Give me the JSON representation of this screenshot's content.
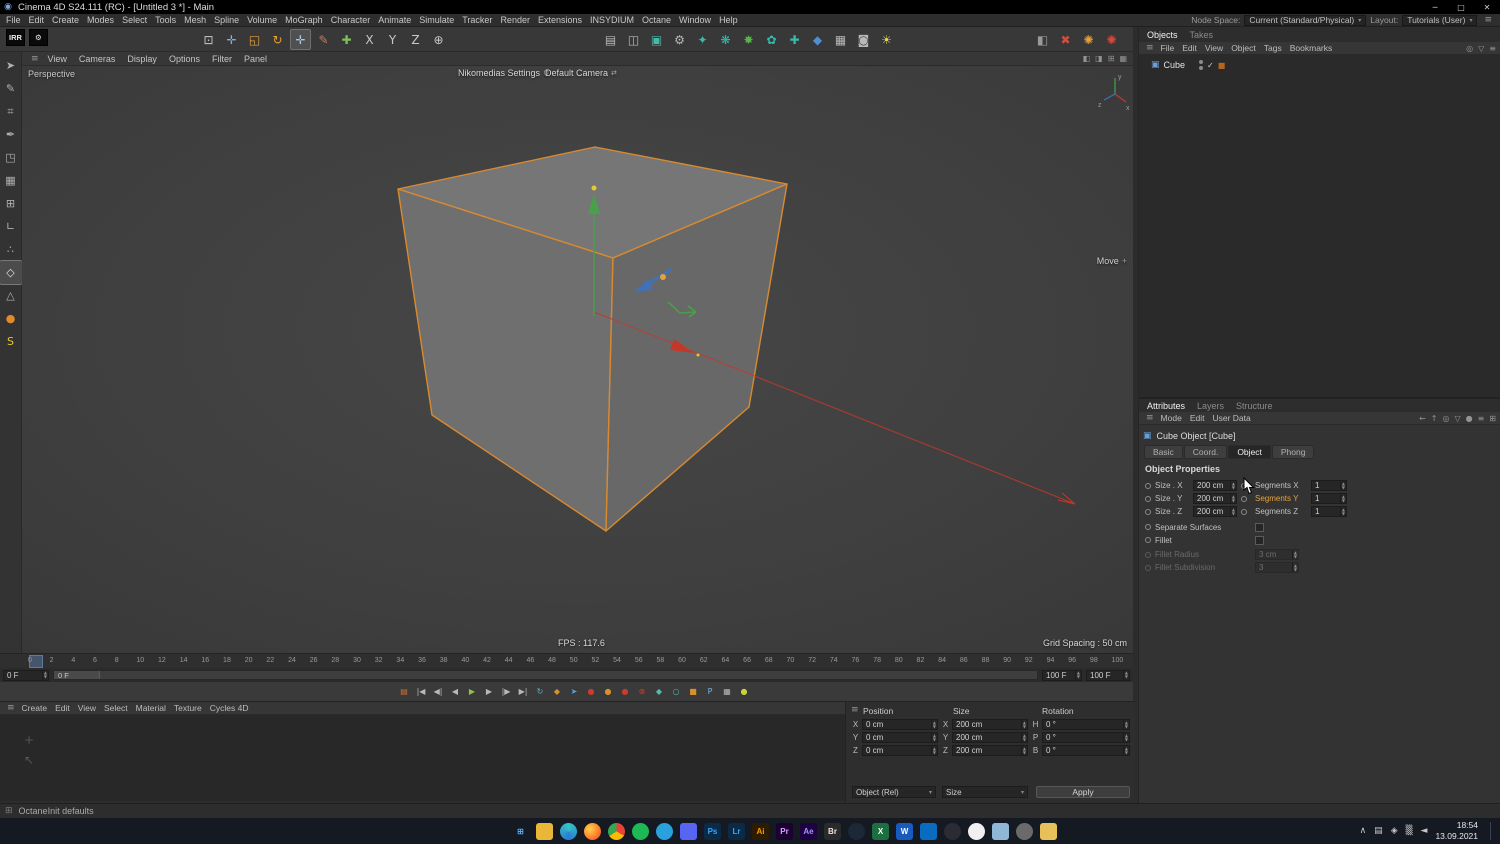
{
  "colors": {
    "accent_orange": "#e8932c",
    "cube_outline": "#d98a2f",
    "selection_blue": "#4a7fb5"
  },
  "icons": {
    "logo": "◉",
    "gear": "⚙",
    "hamburger": "≡",
    "caret_down": "▾",
    "cube": "▣",
    "check": "✓",
    "tag": "■",
    "grip": "≡",
    "move_plus": "+",
    "camera_switch": "⇄",
    "status_grid": "⊞",
    "ghost_plus": "+",
    "ghost_arrow": "↖"
  },
  "title_bar": {
    "title": "Cinema 4D S24.111 (RC) - [Untitled 3 *] - Main",
    "controls": [
      {
        "name": "minimize-button",
        "glyph": "─"
      },
      {
        "name": "maximize-button",
        "glyph": "□"
      },
      {
        "name": "close-button",
        "glyph": "✕"
      }
    ]
  },
  "menu_bar": {
    "items": [
      "File",
      "Edit",
      "Create",
      "Modes",
      "Select",
      "Tools",
      "Mesh",
      "Spline",
      "Volume",
      "MoGraph",
      "Character",
      "Animate",
      "Simulate",
      "Tracker",
      "Render",
      "Extensions",
      "INSYDIUM",
      "Octane",
      "Window",
      "Help"
    ],
    "node_space_label": "Node Space:",
    "node_space_value": "Current (Standard/Physical)",
    "layout_label": "Layout:",
    "layout_value": "Tutorials (User)"
  },
  "toolbar": {
    "left": [
      {
        "name": "irr-button",
        "label": "IRR"
      },
      {
        "name": "plugin-settings-button",
        "glyph": "⚙"
      }
    ],
    "tools": [
      {
        "name": "selection-tool-icon",
        "glyph": "⊡",
        "color": "#c8c8c8"
      },
      {
        "name": "move-tool-icon",
        "glyph": "✛",
        "color": "#7fb2e0"
      },
      {
        "name": "scale-tool-icon",
        "glyph": "◱",
        "color": "#e8a13a"
      },
      {
        "name": "rotate-tool-icon",
        "glyph": "↻",
        "color": "#e8a13a"
      },
      {
        "name": "active-tool-icon",
        "glyph": "✛",
        "color": "#a8c8e8",
        "cls": "pressed"
      },
      {
        "name": "sketch-tool-icon",
        "glyph": "✎",
        "color": "#c87a5a"
      },
      {
        "name": "add-primitive-icon",
        "glyph": "✚",
        "color": "#7fc05a"
      },
      {
        "name": "lock-x-button",
        "glyph": "X",
        "color": "#c8c8c8"
      },
      {
        "name": "lock-y-button",
        "glyph": "Y",
        "color": "#c8c8c8"
      },
      {
        "name": "lock-z-button",
        "glyph": "Z",
        "color": "#c8c8c8"
      },
      {
        "name": "coord-system-button",
        "glyph": "⊕",
        "color": "#c8c8c8"
      }
    ],
    "center": [
      {
        "name": "render-view-button",
        "glyph": "▤",
        "color": "#b8b8b8"
      },
      {
        "name": "render-region-button",
        "glyph": "◫",
        "color": "#b8b8b8"
      },
      {
        "name": "render-picture-viewer-button",
        "glyph": "▣",
        "color": "#4ab8a8"
      },
      {
        "name": "render-settings-button",
        "glyph": "⚙",
        "color": "#b8b8b8"
      },
      {
        "name": "insydium-fx-icon",
        "glyph": "✦",
        "color": "#3db8ac"
      },
      {
        "name": "insydium-particles-icon",
        "glyph": "❋",
        "color": "#3db8ac"
      },
      {
        "name": "insydium-explode-icon",
        "glyph": "✸",
        "color": "#58b54a"
      },
      {
        "name": "insydium-flower-icon",
        "glyph": "✿",
        "color": "#3db8ac"
      },
      {
        "name": "insydium-add-icon",
        "glyph": "✚",
        "color": "#3db8ac"
      },
      {
        "name": "liquid-icon",
        "glyph": "◆",
        "color": "#4a90d8"
      },
      {
        "name": "grid-array-icon",
        "glyph": "▦",
        "color": "#b8b8b8"
      },
      {
        "name": "camera-icon",
        "glyph": "◙",
        "color": "#b8b8b8"
      },
      {
        "name": "light-icon",
        "glyph": "☀",
        "color": "#e8d44a"
      }
    ],
    "right": [
      {
        "name": "octane-dialog-icon",
        "glyph": "◧",
        "color": "#9a9a9a"
      },
      {
        "name": "octane-abort-icon",
        "glyph": "✖",
        "color": "#d84a3a"
      },
      {
        "name": "octane-live-icon",
        "glyph": "✺",
        "color": "#f0a030"
      },
      {
        "name": "octane-stop-icon",
        "glyph": "✺",
        "color": "#d84a3a"
      }
    ]
  },
  "left_toolbar": {
    "tools": [
      {
        "name": "convert-editable-icon",
        "glyph": "➤",
        "color": "#b0b0b0"
      },
      {
        "name": "pencil-tool-icon",
        "glyph": "✎",
        "color": "#b0b0b0"
      },
      {
        "name": "magnet-tool-icon",
        "glyph": "⌗",
        "color": "#b0b0b0"
      },
      {
        "name": "pen-tool-icon",
        "glyph": "✒",
        "color": "#b0b0b0"
      },
      {
        "name": "model-mode-icon",
        "glyph": "◳",
        "color": "#b0b0b0"
      },
      {
        "name": "texture-mode-icon",
        "glyph": "▦",
        "color": "#b0b0b0"
      },
      {
        "name": "workplane-mode-icon",
        "glyph": "⊞",
        "color": "#b0b0b0"
      },
      {
        "name": "enable-axis-icon",
        "glyph": "∟",
        "color": "#b0b0b0"
      },
      {
        "name": "points-mode-icon",
        "glyph": "∴",
        "color": "#b0b0b0"
      },
      {
        "name": "edges-mode-icon",
        "glyph": "◇",
        "color": "#e0e0e0",
        "cls": "active"
      },
      {
        "name": "polygons-mode-icon",
        "glyph": "△",
        "color": "#b0b0b0"
      },
      {
        "name": "octane-ball-icon",
        "glyph": "●",
        "color": "#e08a2a"
      },
      {
        "name": "cycles4d-icon",
        "glyph": "S",
        "color": "#e8c832"
      }
    ]
  },
  "viewport": {
    "menu": [
      "View",
      "Cameras",
      "Display",
      "Options",
      "Filter",
      "Panel"
    ],
    "view_icons": [
      {
        "name": "viewport-single-icon",
        "glyph": "◧"
      },
      {
        "name": "viewport-swap-icon",
        "glyph": "◨"
      },
      {
        "name": "viewport-quad-icon",
        "glyph": "⊞"
      },
      {
        "name": "viewport-maximize-icon",
        "glyph": "▦"
      }
    ],
    "label": "Perspective",
    "settings_overlay": "Nikomedias Settings",
    "camera_overlay": "Default Camera",
    "tool_label": "Move",
    "fps": "FPS : 117.6",
    "grid_spacing": "Grid Spacing : 50 cm"
  },
  "objects_panel": {
    "tabs": [
      {
        "label": "Objects",
        "active": true
      },
      {
        "label": "Takes"
      }
    ],
    "menu": [
      "File",
      "Edit",
      "View",
      "Object",
      "Tags",
      "Bookmarks"
    ],
    "menu_icons": [
      {
        "name": "search-icon",
        "glyph": "◎"
      },
      {
        "name": "filter-icon",
        "glyph": "▽"
      },
      {
        "name": "panel-menu-icon",
        "glyph": "≡"
      }
    ],
    "items": [
      {
        "label": "Cube"
      }
    ]
  },
  "attributes_panel": {
    "tabs": [
      {
        "label": "Attributes",
        "active": true
      },
      {
        "label": "Layers"
      },
      {
        "label": "Structure"
      }
    ],
    "menu": [
      "Mode",
      "Edit",
      "User Data"
    ],
    "menu_icons": [
      {
        "name": "back-icon",
        "glyph": "←"
      },
      {
        "name": "up-icon",
        "glyph": "↑"
      },
      {
        "name": "search-icon",
        "glyph": "◎"
      },
      {
        "name": "filter-icon",
        "glyph": "▽"
      },
      {
        "name": "lock-icon",
        "glyph": "●"
      },
      {
        "name": "menu-icon",
        "glyph": "≡"
      },
      {
        "name": "new-panel-icon",
        "glyph": "⊞"
      }
    ],
    "object_title": "Cube Object [Cube]",
    "section_tabs": [
      {
        "label": "Basic"
      },
      {
        "label": "Coord."
      },
      {
        "label": "Object",
        "active": true
      },
      {
        "label": "Phong"
      }
    ],
    "section_title": "Object Properties",
    "size_rows": [
      {
        "label": "Size . X",
        "value": "200 cm",
        "label2": "Segments X",
        "value2": "1"
      },
      {
        "label": "Size . Y",
        "value": "200 cm",
        "label2": "Segments Y",
        "value2": "1",
        "cls": "hl"
      },
      {
        "label": "Size . Z",
        "value": "200 cm",
        "label2": "Segments Z",
        "value2": "1"
      }
    ],
    "check_rows": [
      {
        "label": "Separate Surfaces"
      },
      {
        "label": "Fillet"
      }
    ],
    "disabled_rows": [
      {
        "label": "Fillet Radius",
        "value": "3 cm"
      },
      {
        "label": "Fillet Subdivision",
        "value": "3"
      }
    ]
  },
  "timeline": {
    "ticks": [
      "0",
      "2",
      "4",
      "6",
      "8",
      "10",
      "12",
      "14",
      "16",
      "18",
      "20",
      "22",
      "24",
      "26",
      "28",
      "30",
      "32",
      "34",
      "36",
      "38",
      "40",
      "42",
      "44",
      "46",
      "48",
      "50",
      "52",
      "54",
      "56",
      "58",
      "60",
      "62",
      "64",
      "66",
      "68",
      "70",
      "72",
      "74",
      "76",
      "78",
      "80",
      "82",
      "84",
      "86",
      "88",
      "90",
      "92",
      "94",
      "96",
      "98",
      "100"
    ],
    "start_field": "0 F",
    "marker_label": "0 F",
    "end_field": "100 F",
    "end_field2": "100 F"
  },
  "transport": {
    "buttons": [
      {
        "name": "timeline-palette-icon",
        "glyph": "▤",
        "color": "#d07030"
      },
      {
        "name": "go-to-start-button",
        "glyph": "|◀"
      },
      {
        "name": "previous-key-button",
        "glyph": "◀|"
      },
      {
        "name": "previous-frame-button",
        "glyph": "◀"
      },
      {
        "name": "play-forwards-button",
        "glyph": "▶",
        "color": "#8ac44a"
      },
      {
        "name": "next-frame-button",
        "glyph": "▶"
      },
      {
        "name": "next-key-button",
        "glyph": "|▶"
      },
      {
        "name": "go-to-end-button",
        "glyph": "▶|"
      },
      {
        "name": "loop-mode-icon",
        "glyph": "↻",
        "color": "#53b9b4"
      },
      {
        "name": "sound-toggle-icon",
        "glyph": "◆",
        "color": "#d8902a"
      },
      {
        "name": "autokey-pointer-icon",
        "glyph": "➤",
        "color": "#5a9fd4"
      },
      {
        "name": "record-button",
        "glyph": "●",
        "color": "#cc3b30"
      },
      {
        "name": "key-position-button",
        "glyph": "●",
        "color": "#d8902a"
      },
      {
        "name": "key-scale-button",
        "glyph": "●",
        "color": "#cc3b30"
      },
      {
        "name": "key-rotation-button",
        "glyph": "⊗",
        "color": "#cc3b30"
      },
      {
        "name": "snap-magnet-icon",
        "glyph": "◆",
        "color": "#53b9b4"
      },
      {
        "name": "keyframe-circle-icon",
        "glyph": "○",
        "color": "#53b9b4"
      },
      {
        "name": "param-key-icon",
        "glyph": "■",
        "color": "#d8902a"
      },
      {
        "name": "pla-key-icon",
        "glyph": "P",
        "color": "#7ab3e0"
      },
      {
        "name": "snap-grid-icon",
        "glyph": "▦",
        "color": "#b8b8b8"
      },
      {
        "name": "cappuccino-icon",
        "glyph": "●",
        "color": "#c9d43a"
      }
    ]
  },
  "material_manager": {
    "menu": [
      "Create",
      "Edit",
      "View",
      "Select",
      "Material",
      "Texture",
      "Cycles 4D"
    ]
  },
  "coordinates": {
    "position_header": "Position",
    "size_header": "Size",
    "rotation_header": "Rotation",
    "position_rows": [
      {
        "axis": "X",
        "value": "0 cm"
      },
      {
        "axis": "Y",
        "value": "0 cm"
      },
      {
        "axis": "Z",
        "value": "0 cm"
      }
    ],
    "size_rows": [
      {
        "axis": "X",
        "value": "200 cm"
      },
      {
        "axis": "Y",
        "value": "200 cm"
      },
      {
        "axis": "Z",
        "value": "200 cm"
      }
    ],
    "rotation_rows": [
      {
        "axis": "H",
        "value": "0 °"
      },
      {
        "axis": "P",
        "value": "0 °"
      },
      {
        "axis": "B",
        "value": "0 °"
      }
    ],
    "mode_dropdown": "Object (Rel)",
    "target_dropdown": "Size",
    "apply_label": "Apply"
  },
  "status_bar": {
    "text": "OctaneInit defaults"
  },
  "taskbar": {
    "icons": [
      {
        "name": "start-button",
        "label": "⊞",
        "fg": "#5aa7e8",
        "bg": "transparent"
      },
      {
        "name": "file-explorer-icon",
        "label": "",
        "bg": "#e8b73a",
        "cls": "rounded"
      },
      {
        "name": "edge-icon",
        "label": "",
        "bg": "conic-gradient(#35c2c5, #2b7cd3, #35c2c5)",
        "cls": "circle"
      },
      {
        "name": "firefox-icon",
        "label": "",
        "bg": "radial-gradient(circle at 35% 35%, #ffd24a, #ff7a2d 60%, #e8452c)",
        "cls": "circle"
      },
      {
        "name": "chrome-icon",
        "label": "",
        "bg": "conic-gradient(#ea4335 0 33%, #fbbc05 33% 66%, #34a853 66% 100%)",
        "cls": "circle"
      },
      {
        "name": "spotify-icon",
        "label": "",
        "bg": "#1db954",
        "cls": "circle"
      },
      {
        "name": "telegram-icon",
        "label": "",
        "bg": "#2aa1da",
        "cls": "circle"
      },
      {
        "name": "discord-icon",
        "label": "",
        "bg": "#5865f2",
        "cls": "rounded"
      },
      {
        "name": "photoshop-icon",
        "label": "Ps",
        "fg": "#31a8ff",
        "bg": "#0b2a45",
        "cls": "rounded"
      },
      {
        "name": "lightroom-icon",
        "label": "Lr",
        "fg": "#31a8ff",
        "bg": "#0b2a45",
        "cls": "rounded"
      },
      {
        "name": "illustrator-icon",
        "label": "Ai",
        "fg": "#ff9a00",
        "bg": "#2e1c00",
        "cls": "rounded"
      },
      {
        "name": "premiere-icon",
        "label": "Pr",
        "fg": "#d8a1ff",
        "bg": "#1a0033",
        "cls": "rounded"
      },
      {
        "name": "after-effects-icon",
        "label": "Ae",
        "fg": "#9999ff",
        "bg": "#1f0040",
        "cls": "rounded"
      },
      {
        "name": "bridge-icon",
        "label": "Br",
        "fg": "#e8e8e8",
        "bg": "#2a2a2a",
        "cls": "rounded"
      },
      {
        "name": "steam-icon",
        "label": "",
        "bg": "#1b2838",
        "cls": "circle"
      },
      {
        "name": "excel-icon",
        "label": "X",
        "fg": "#ffffff",
        "bg": "#1d6f42",
        "cls": "rounded"
      },
      {
        "name": "word-icon",
        "label": "W",
        "fg": "#ffffff",
        "bg": "#185abd",
        "cls": "rounded"
      },
      {
        "name": "vscode-icon",
        "label": "",
        "bg": "#0a6cc0",
        "cls": "rounded"
      },
      {
        "name": "obs-icon",
        "label": "",
        "bg": "#2b2b33",
        "cls": "circle"
      },
      {
        "name": "paint-icon",
        "label": "",
        "bg": "#f0f0f0",
        "cls": "circle"
      },
      {
        "name": "notepad-icon",
        "label": "",
        "bg": "#8fb7d8",
        "cls": "rounded"
      },
      {
        "name": "settings-icon",
        "label": "",
        "bg": "#6a6a6a",
        "cls": "circle"
      },
      {
        "name": "folder-icon",
        "label": "",
        "bg": "#e8c05a",
        "cls": "rounded"
      }
    ],
    "tray_icons": [
      {
        "name": "hidden-icons-chevron",
        "glyph": "∧"
      },
      {
        "name": "onedrive-icon",
        "glyph": "▤"
      },
      {
        "name": "shield-icon",
        "glyph": "◈"
      },
      {
        "name": "network-icon",
        "glyph": "▒"
      },
      {
        "name": "volume-icon",
        "glyph": "◄"
      }
    ],
    "time": "18:54",
    "date": "13.09.2021"
  }
}
